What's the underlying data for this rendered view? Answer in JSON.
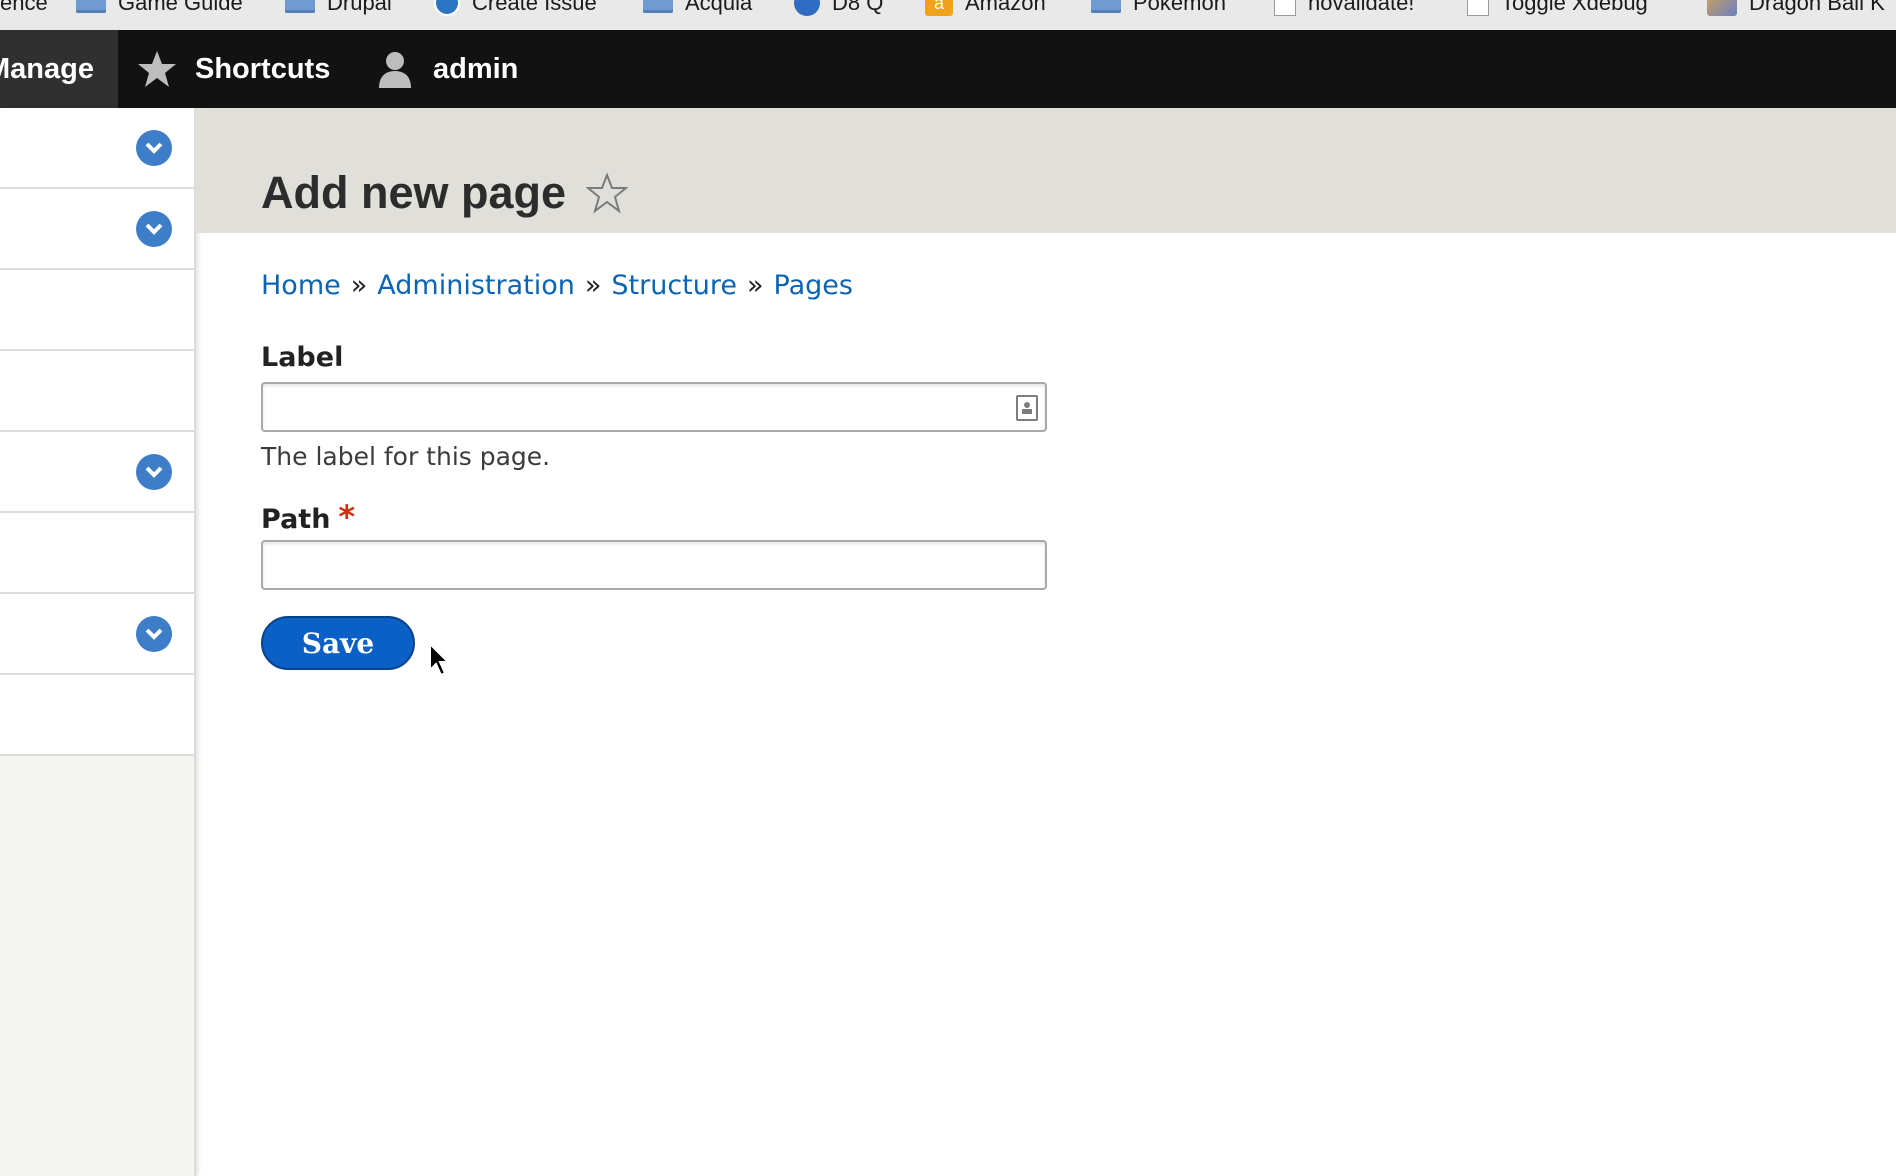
{
  "bookmarks": [
    {
      "label": "ence",
      "icon": "none"
    },
    {
      "label": "Game Guide",
      "icon": "folder-icon"
    },
    {
      "label": "Drupal",
      "icon": "folder-icon"
    },
    {
      "label": "Create Issue",
      "icon": "drupal-drop-icon"
    },
    {
      "label": "Acquia",
      "icon": "folder-icon"
    },
    {
      "label": "D8 Q",
      "icon": "globe-icon"
    },
    {
      "label": "Amazon",
      "icon": "amazon-icon"
    },
    {
      "label": "Pokemon",
      "icon": "folder-icon"
    },
    {
      "label": "novalidate!",
      "icon": "page-icon"
    },
    {
      "label": "Toggle Xdebug",
      "icon": "page-icon"
    },
    {
      "label": "Dragon Ball K",
      "icon": "image-icon"
    }
  ],
  "toolbar": {
    "manage_label": "Manage",
    "shortcuts_label": "Shortcuts",
    "user_label": "admin"
  },
  "page": {
    "title": "Add new page"
  },
  "breadcrumb": {
    "items": [
      "Home",
      "Administration",
      "Structure",
      "Pages"
    ],
    "separator": "»"
  },
  "form": {
    "label_field": {
      "label": "Label",
      "value": "",
      "description": "The label for this page."
    },
    "path_field": {
      "label": "Path",
      "required_marker": "*",
      "value": ""
    },
    "save_label": "Save"
  },
  "colors": {
    "link": "#0c64b5",
    "button": "#0a60c4",
    "toolbar": "#121212",
    "header_bg": "#e0dfd9",
    "required": "#d32f0c"
  }
}
